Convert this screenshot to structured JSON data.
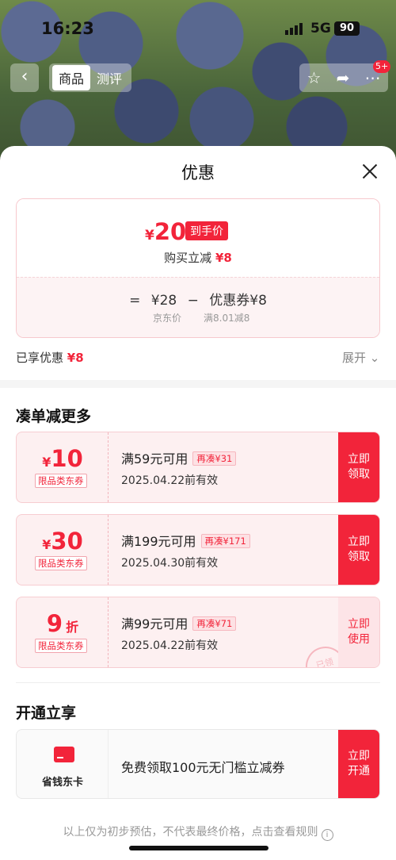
{
  "status_bar": {
    "time": "16:23",
    "network": "5G",
    "battery": "90"
  },
  "nav": {
    "back_icon": "chevron-left-icon",
    "tabs": [
      {
        "label": "商品"
      },
      {
        "label": "测评"
      }
    ],
    "actions": [
      "star-icon",
      "share-icon",
      "more-icon"
    ],
    "message_badge": "5+"
  },
  "sheet": {
    "title": "优惠",
    "price_card": {
      "currency": "¥",
      "final_price": "20",
      "final_tag": "到手价",
      "instant_label": "购买立减",
      "instant_value": "¥8",
      "equals": "=",
      "jd_price": "¥28",
      "minus": "−",
      "coupon_label": "优惠券¥8",
      "jd_price_label": "京东价",
      "coupon_cond": "满8.01减8"
    },
    "enjoyed_label": "已享优惠",
    "enjoyed_value": "¥8",
    "expand_label": "展开",
    "combine_title": "凑单减更多",
    "coupons": [
      {
        "yen": "¥",
        "amount": "10",
        "unit": "",
        "category": "限品类东券",
        "condition": "满59元可用",
        "more": "再凑¥31",
        "expiry": "2025.04.22前有效",
        "button": "立即\n领取"
      },
      {
        "yen": "¥",
        "amount": "30",
        "unit": "",
        "category": "限品类东券",
        "condition": "满199元可用",
        "more": "再凑¥171",
        "expiry": "2025.04.30前有效",
        "button": "立即\n领取"
      },
      {
        "yen": "",
        "amount": "9",
        "unit": "折",
        "category": "限品类东券",
        "condition": "满99元可用",
        "more": "再凑¥71",
        "expiry": "2025.04.22前有效",
        "button": "立即\n使用",
        "stamp": "已领"
      }
    ],
    "member_title": "开通立享",
    "member_card": {
      "name": "省钱东卡",
      "desc": "免费领取100元无门槛立减券",
      "button": "立即\n开通"
    },
    "footer_note": "以上仅为初步预估，不代表最终价格，点击查看规则",
    "colors": {
      "accent": "#f2243a",
      "coupon_bg": "#fdf0f1"
    }
  }
}
